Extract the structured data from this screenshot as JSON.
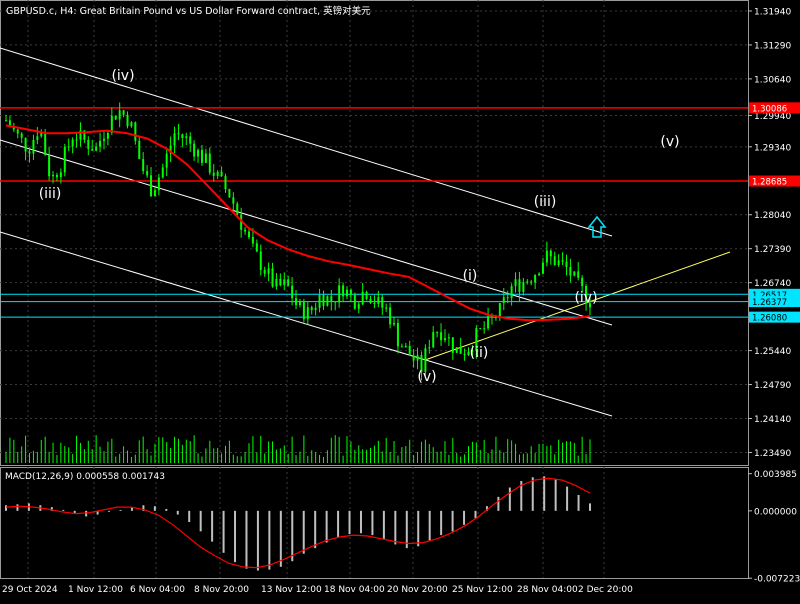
{
  "header": {
    "title": "GBPUSD.c, H4:  Great Britain Pound vs US Dollar Forward contract, 英镑对美元"
  },
  "colors": {
    "background": "#000000",
    "grid": "#3c3c3c",
    "candles": "#00ff00",
    "ma": "#ff0000",
    "resistance": "#ff0000",
    "support": "#00e5ff",
    "channel": "#ffffff",
    "trendline": "#ffff66",
    "arrow": "#00e5ff",
    "volume": "#00ff00",
    "macd_hist": "#c0c0c0",
    "macd_signal": "#ff0000"
  },
  "chart_data": [
    {
      "type": "candlestick",
      "title": "GBPUSD.c, H4:  Great Britain Pound vs US Dollar Forward contract, 英镑对美元",
      "yaxis_ticks": [
        "1.31940",
        "1.31290",
        "1.30640",
        "1.29940",
        "1.29340",
        "1.28040",
        "1.27390",
        "1.26740",
        "1.25440",
        "1.24790",
        "1.24140",
        "1.23490"
      ],
      "ylim": [
        1.2325,
        1.3215
      ],
      "xaxis_ticks": [
        "29 Oct 2024",
        "1 Nov 12:00",
        "6 Nov 04:00",
        "8 Nov 20:00",
        "13 Nov 12:00",
        "18 Nov 04:00",
        "20 Nov 20:00",
        "25 Nov 12:00",
        "28 Nov 04:00",
        "2 Dec 20:00"
      ],
      "close_path": [
        1.2985,
        1.2955,
        1.293,
        1.2975,
        1.287,
        1.2905,
        1.296,
        1.2945,
        1.293,
        1.2975,
        1.3005,
        1.2985,
        1.29,
        1.285,
        1.2895,
        1.296,
        1.295,
        1.2925,
        1.29,
        1.287,
        1.284,
        1.2785,
        1.2735,
        1.27,
        1.2665,
        1.267,
        1.2625,
        1.2615,
        1.265,
        1.264,
        1.2665,
        1.264,
        1.266,
        1.2635,
        1.262,
        1.256,
        1.2535,
        1.251,
        1.2585,
        1.258,
        1.2545,
        1.2545,
        1.2575,
        1.2595,
        1.262,
        1.2665,
        1.2675,
        1.269,
        1.2725,
        1.2715,
        1.27,
        1.2665,
        1.264
      ],
      "moving_average": [
        1.2975,
        1.2968,
        1.296,
        1.296,
        1.2962,
        1.2965,
        1.296,
        1.295,
        1.293,
        1.29,
        1.286,
        1.282,
        1.278,
        1.2755,
        1.2738,
        1.2725,
        1.2715,
        1.2708,
        1.27,
        1.2692,
        1.2685,
        1.2665,
        1.2645,
        1.2625,
        1.2612,
        1.2605,
        1.2602,
        1.2603,
        1.2605,
        1.261
      ],
      "horizontal_levels": [
        {
          "name": "resistance-1",
          "value": "1.30086"
        },
        {
          "name": "resistance-2",
          "value": "1.28685"
        },
        {
          "name": "support-1",
          "value": "1.26517"
        },
        {
          "name": "support-2",
          "value": "1.26377"
        },
        {
          "name": "support-3",
          "value": "1.26080"
        }
      ],
      "annotations": [
        "(iv)",
        "(iii)",
        "(v)",
        "(i)",
        "(ii)",
        "(iii)",
        "(iv)",
        "(v)"
      ]
    },
    {
      "type": "histogram",
      "title": "MACD(12,26,9) 0.000558 0.001743",
      "yaxis_ticks": [
        "0.003985",
        "0.000000",
        "-0.007223"
      ],
      "ylim": [
        -0.0072,
        0.0047
      ],
      "histogram": [
        0.0006,
        0.0007,
        0.0008,
        0.0006,
        0.0004,
        0.0001,
        -0.0003,
        -0.0006,
        -0.0004,
        -0.0001,
        0.0001,
        0.0004,
        0.0006,
        0.0005,
        0.0002,
        -0.0004,
        -0.0012,
        -0.0022,
        -0.0033,
        -0.0045,
        -0.0055,
        -0.0062,
        -0.0064,
        -0.0063,
        -0.006,
        -0.0054,
        -0.0046,
        -0.004,
        -0.0034,
        -0.0028,
        -0.0025,
        -0.0024,
        -0.0026,
        -0.003,
        -0.0036,
        -0.004,
        -0.0038,
        -0.0032,
        -0.0026,
        -0.0022,
        -0.0015,
        -0.0008,
        0.0005,
        0.0015,
        0.0025,
        0.0032,
        0.0036,
        0.0037,
        0.0034,
        0.0026,
        0.0017,
        0.0008
      ],
      "signal": [
        0.0004,
        0.0005,
        0.0004,
        0.0002,
        -0.0001,
        -0.0003,
        -0.0002,
        0.0001,
        0.0004,
        0.0004,
        0.0001,
        -0.0005,
        -0.0015,
        -0.0027,
        -0.0039,
        -0.0048,
        -0.0056,
        -0.006,
        -0.0061,
        -0.0058,
        -0.0052,
        -0.0045,
        -0.0038,
        -0.0032,
        -0.0028,
        -0.0026,
        -0.0027,
        -0.003,
        -0.0033,
        -0.0035,
        -0.0034,
        -0.003,
        -0.0024,
        -0.0016,
        -0.0006,
        0.0006,
        0.0017,
        0.0027,
        0.0033,
        0.0035,
        0.0033,
        0.0027,
        0.0019
      ]
    }
  ]
}
